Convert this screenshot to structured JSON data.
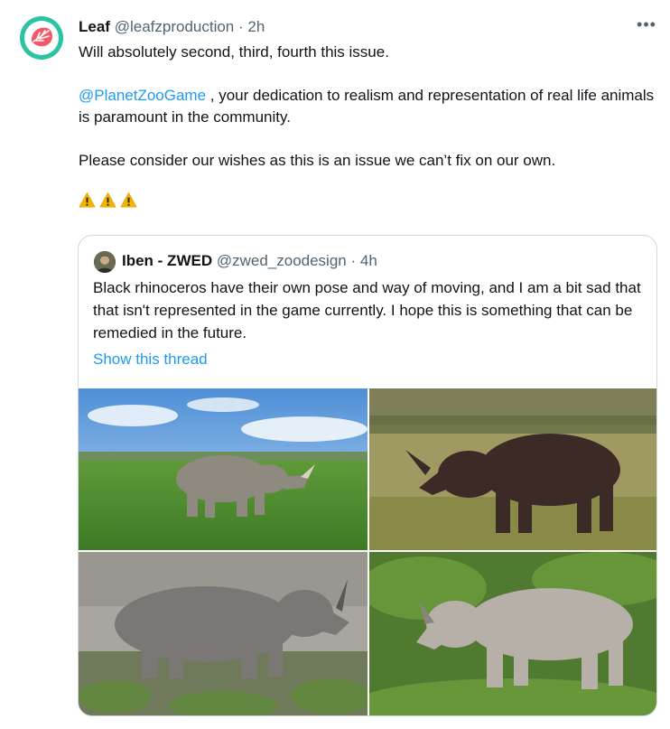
{
  "tweet": {
    "display_name": "Leaf",
    "handle": "@leafzproduction",
    "separator": "·",
    "time": "2h",
    "more_label": "•••",
    "line1": "Will absolutely second, third, fourth this issue.",
    "mention": "@PlanetZooGame",
    "line2_rest": " , your dedication to realism and representation of real life animals is paramount in the community.",
    "line3": "Please consider our wishes as this is an issue we can’t fix on our own."
  },
  "quote": {
    "display_name": "Iben - ZWED",
    "handle": "@zwed_zoodesign",
    "separator": "·",
    "time": "4h",
    "text": "Black rhinoceros have their own pose and way of moving, and I am a bit sad that that isn't represented in the game currently. I hope this is something that can be remedied in the future.",
    "show_thread": "Show this thread"
  },
  "colors": {
    "accent": "#1d9bf0",
    "muted": "#536471",
    "border": "#cfd9de",
    "avatar_bg": "#2cc3a5",
    "warning": "#f4b400"
  },
  "icons": [
    "leaf-avatar-logo",
    "warning-icon",
    "more-icon"
  ]
}
